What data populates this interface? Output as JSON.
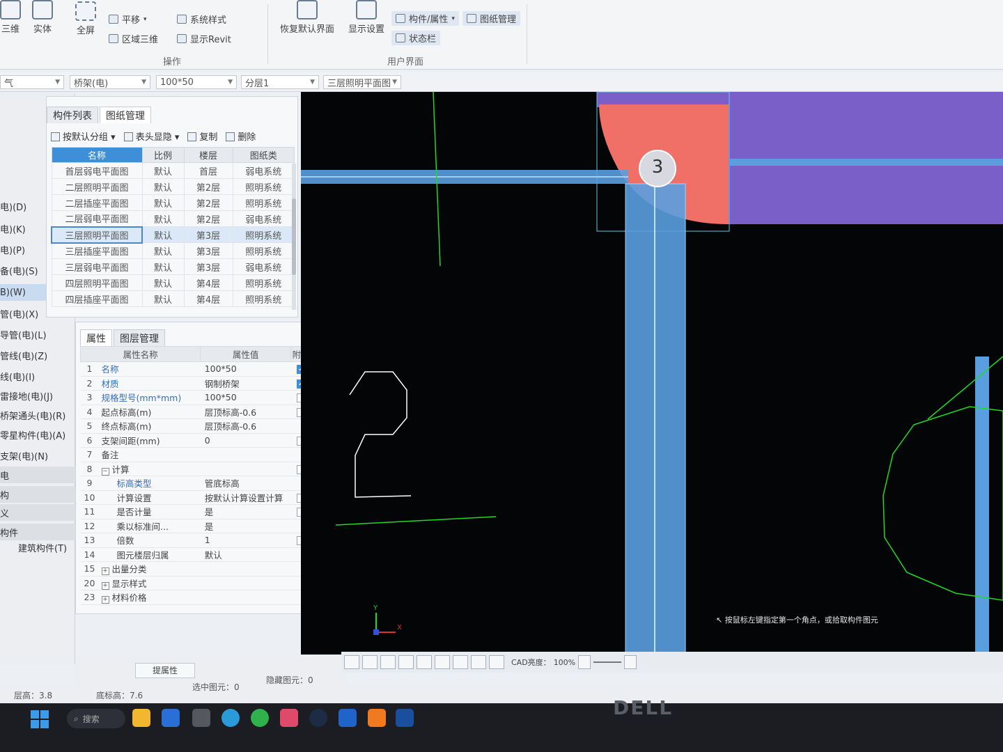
{
  "ribbon": {
    "view_3d": "三维",
    "solid": "实体",
    "fullscreen": "全屏",
    "pan": "平移",
    "region_3d": "区域三维",
    "system_style": "系统样式",
    "show_revit": "显示Revit",
    "restore_default": "恢复默认界面",
    "display_settings": "显示设置",
    "component_props": "构件/属性",
    "drawing_mgmt": "图纸管理",
    "status_bar": "状态栏",
    "group_operation": "操作",
    "group_user_interface": "用户界面"
  },
  "toolbar": {
    "category": "桥架(电)",
    "spec": "100*50",
    "layer": "分层1",
    "drawing": "三层照明平面图"
  },
  "leftnav": {
    "items": [
      {
        "label": "电)(D)"
      },
      {
        "label": "电)(K)"
      },
      {
        "label": "电)(P)"
      },
      {
        "label": "备(电)(S)"
      },
      {
        "label": "B)(W)",
        "selected": true
      },
      {
        "label": "管(电)(X)"
      },
      {
        "label": "导管(电)(L)"
      },
      {
        "label": "管线(电)(Z)"
      },
      {
        "label": "线(电)(I)"
      },
      {
        "label": "雷接地(电)(J)"
      },
      {
        "label": "桥架通头(电)(R)"
      },
      {
        "label": "零星构件(电)(A)"
      },
      {
        "label": "支架(电)(N)"
      },
      {
        "label": "电"
      },
      {
        "label": "构"
      },
      {
        "label": "义"
      },
      {
        "label": "构件"
      },
      {
        "label": "建筑构件(T)"
      }
    ]
  },
  "component_panel": {
    "tabs": [
      "构件列表",
      "图纸管理"
    ],
    "tools": {
      "group_default": "按默认分组",
      "header_toggle": "表头显隐",
      "copy": "复制",
      "delete": "删除"
    },
    "columns": [
      "名称",
      "比例",
      "楼层",
      "图纸类"
    ],
    "rows": [
      {
        "name": "首层弱电平面图",
        "scale": "默认",
        "floor": "首层",
        "type": "弱电系统"
      },
      {
        "name": "二层照明平面图",
        "scale": "默认",
        "floor": "第2层",
        "type": "照明系统"
      },
      {
        "name": "二层插座平面图",
        "scale": "默认",
        "floor": "第2层",
        "type": "照明系统"
      },
      {
        "name": "二层弱电平面图",
        "scale": "默认",
        "floor": "第2层",
        "type": "弱电系统"
      },
      {
        "name": "三层照明平面图",
        "scale": "默认",
        "floor": "第3层",
        "type": "照明系统",
        "selected": true
      },
      {
        "name": "三层插座平面图",
        "scale": "默认",
        "floor": "第3层",
        "type": "照明系统"
      },
      {
        "name": "三层弱电平面图",
        "scale": "默认",
        "floor": "第3层",
        "type": "弱电系统"
      },
      {
        "name": "四层照明平面图",
        "scale": "默认",
        "floor": "第4层",
        "type": "照明系统"
      },
      {
        "name": "四层插座平面图",
        "scale": "默认",
        "floor": "第4层",
        "type": "照明系统"
      }
    ]
  },
  "property_panel": {
    "tabs": [
      "属性",
      "图层管理"
    ],
    "columns": [
      "属性名称",
      "属性值",
      "附加"
    ],
    "rows": [
      {
        "no": "1",
        "name": "名称",
        "value": "100*50",
        "blue": true,
        "check": "on"
      },
      {
        "no": "2",
        "name": "材质",
        "value": "钢制桥架",
        "blue": true,
        "check": "on"
      },
      {
        "no": "3",
        "name": "规格型号(mm*mm)",
        "value": "100*50",
        "blue": true,
        "check": "off"
      },
      {
        "no": "4",
        "name": "起点标高(m)",
        "value": "层顶标高-0.6",
        "check": "off"
      },
      {
        "no": "5",
        "name": "终点标高(m)",
        "value": "层顶标高-0.6",
        "check": "none"
      },
      {
        "no": "6",
        "name": "支架间距(mm)",
        "value": "0",
        "check": "off"
      },
      {
        "no": "7",
        "name": "备注",
        "value": "",
        "check": "none"
      },
      {
        "no": "8",
        "name": "计算",
        "value": "",
        "expand": "minus",
        "check": "off"
      },
      {
        "no": "9",
        "name": "标高类型",
        "value": "管底标高",
        "blue": true,
        "indent": true,
        "check": "none"
      },
      {
        "no": "10",
        "name": "计算设置",
        "value": "按默认计算设置计算",
        "indent": true,
        "check": "off"
      },
      {
        "no": "11",
        "name": "是否计量",
        "value": "是",
        "indent": true,
        "check": "off"
      },
      {
        "no": "12",
        "name": "乘以标准间...",
        "value": "是",
        "indent": true,
        "check": "none"
      },
      {
        "no": "13",
        "name": "倍数",
        "value": "1",
        "indent": true,
        "check": "off"
      },
      {
        "no": "14",
        "name": "图元楼层归属",
        "value": "默认",
        "indent": true,
        "check": "none"
      },
      {
        "no": "15",
        "name": "出量分类",
        "value": "",
        "expand": "plus",
        "check": "none"
      },
      {
        "no": "20",
        "name": "显示样式",
        "value": "",
        "expand": "plus",
        "check": "none"
      },
      {
        "no": "23",
        "name": "材料价格",
        "value": "",
        "expand": "plus",
        "check": "none"
      }
    ],
    "pick_button": "提属性"
  },
  "statusbar": {
    "floor_height": "层高：3.8",
    "bottom_elev": "底标高：7.6",
    "selected": "选中图元：0",
    "hidden": "隐藏图元：0"
  },
  "cad": {
    "bubble_label": "3",
    "big_glyph": "2",
    "prompt": "按鼠标左键指定第一个角点，或拾取构件图元",
    "brightness_label": "CAD亮度：",
    "brightness_value": "100%",
    "axis_x": "X",
    "axis_y": "Y"
  },
  "taskbar": {
    "search": "搜索"
  },
  "monitor_brand": "DELL",
  "colors": {
    "accent": "#3d8fd8",
    "cad_bg": "#040506",
    "tray_blue": "#5a9ee0",
    "wall_purple": "#7a5fc8",
    "column_red": "#f07068",
    "axis_green": "#22d822"
  }
}
